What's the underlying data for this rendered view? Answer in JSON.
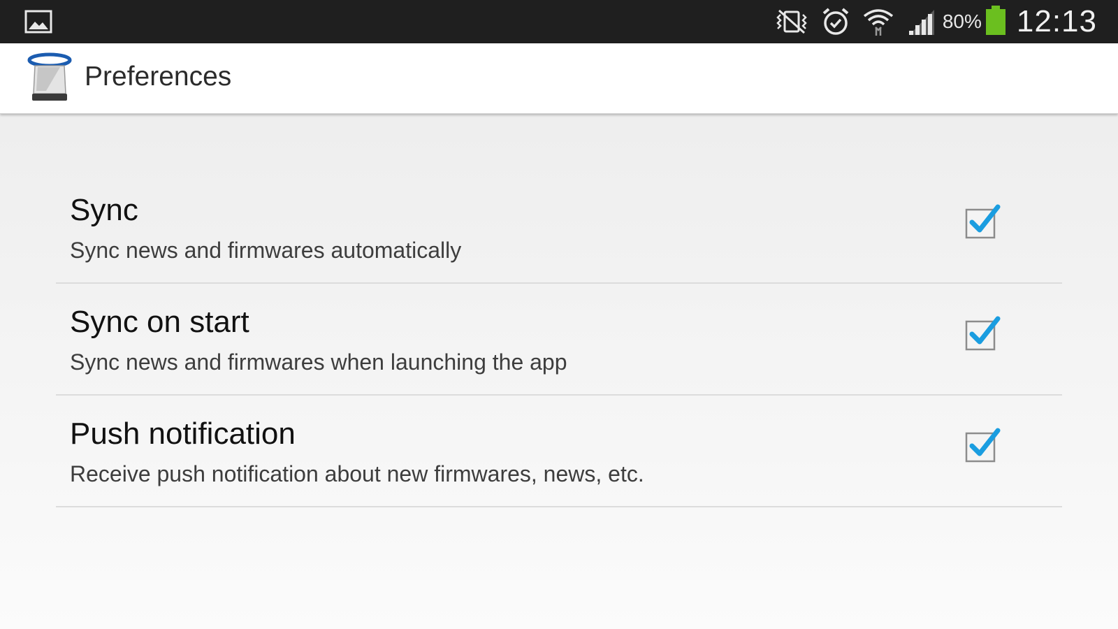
{
  "status_bar": {
    "left_icons": [
      "gallery-icon"
    ],
    "right_icons": [
      "vibrate-mute-icon",
      "alarm-icon",
      "wifi-icon",
      "signal-icon",
      "battery-icon"
    ],
    "battery_percent": "80%",
    "battery_color": "#6bbf1f",
    "time": "12:13"
  },
  "action_bar": {
    "app_icon": "phone-app-icon",
    "title": "Preferences"
  },
  "accent_color": "#1a9de0",
  "preferences": [
    {
      "title": "Sync",
      "summary": "Sync news and firmwares automatically",
      "checked": true
    },
    {
      "title": "Sync on start",
      "summary": "Sync news and firmwares when launching the app",
      "checked": true
    },
    {
      "title": "Push notification",
      "summary": "Receive push notification about new firmwares, news, etc.",
      "checked": true
    }
  ]
}
